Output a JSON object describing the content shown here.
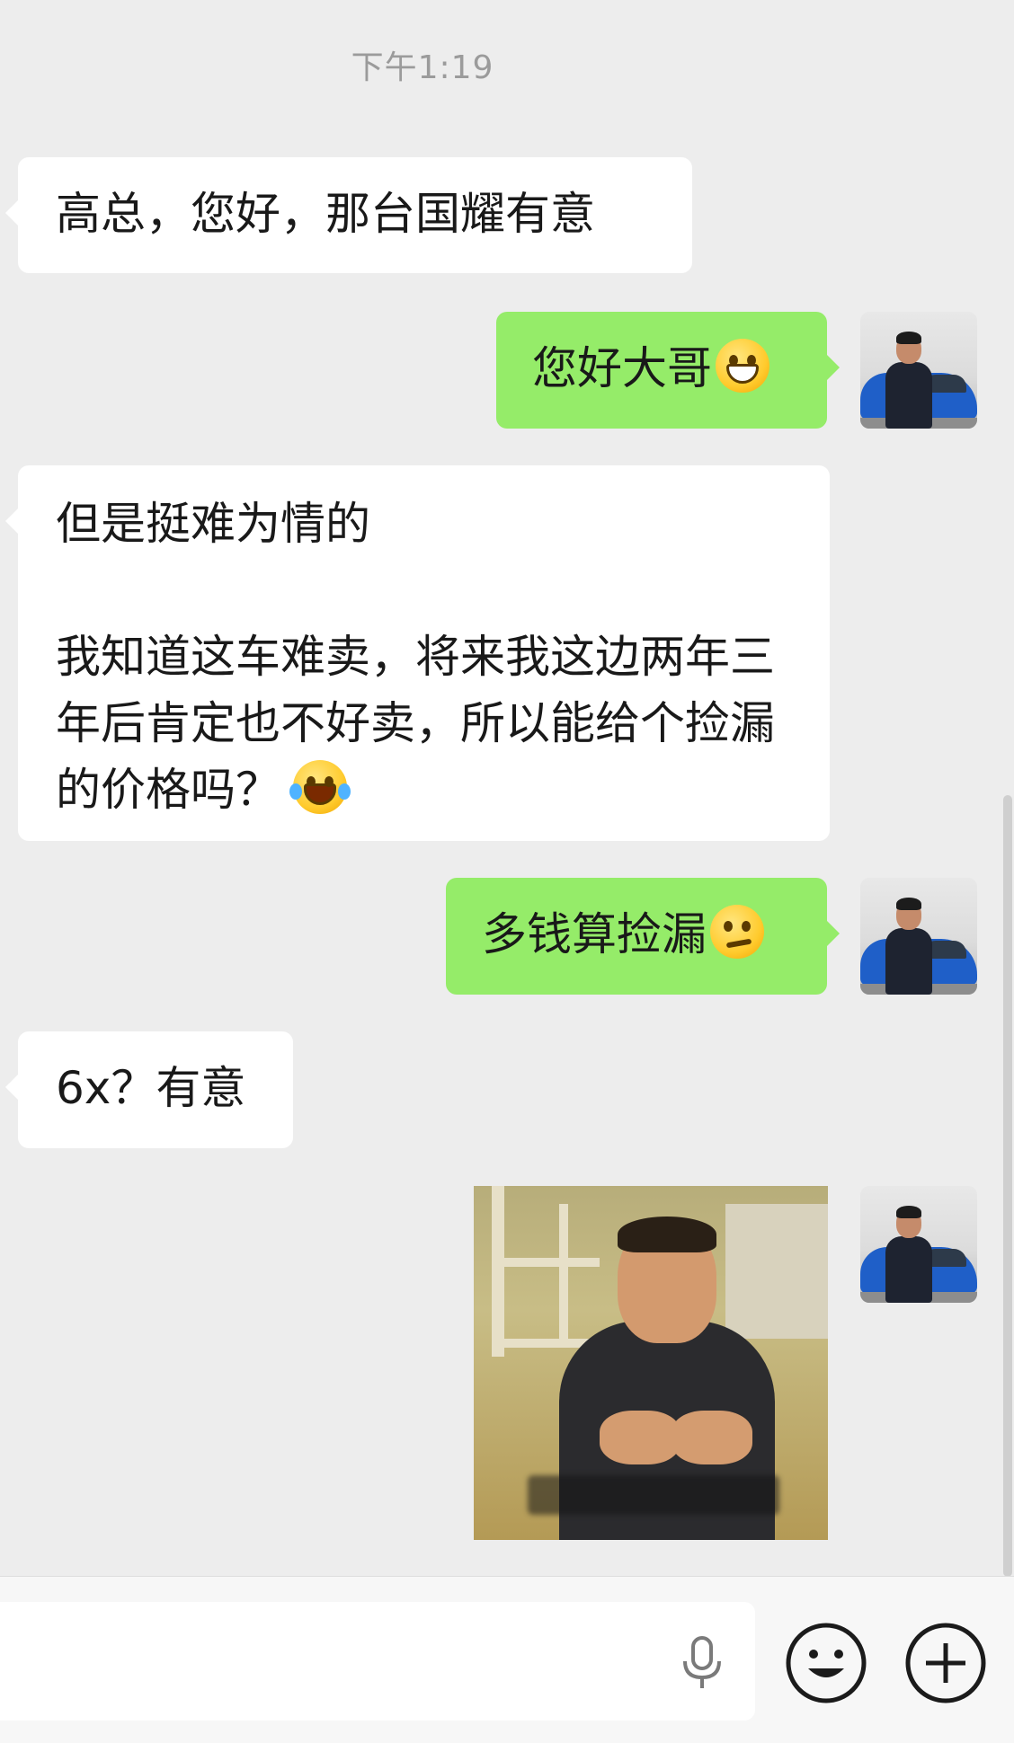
{
  "chat": {
    "timestamp": "下午1:19",
    "messages": [
      {
        "side": "left",
        "type": "text",
        "text": "高总，您好，那台国耀有意"
      },
      {
        "side": "right",
        "type": "text",
        "text": "您好大哥",
        "emoji": "grinning-emoji"
      },
      {
        "side": "left",
        "type": "text",
        "text": "但是挺难为情的\n\n我知道这车难卖，将来我这边两年三年后肯定也不好卖，所以能给个捡漏的价格吗？",
        "emoji": "tears-of-joy-emoji"
      },
      {
        "side": "right",
        "type": "text",
        "text": "多钱算捡漏",
        "emoji": "smirk-emoji"
      },
      {
        "side": "left",
        "type": "text",
        "text": "6x？有意"
      },
      {
        "side": "right",
        "type": "sticker",
        "sticker": "man-clutching-chest-sticker"
      }
    ]
  },
  "input_bar": {
    "voice_icon": "microphone-icon",
    "emoji_icon": "smiley-face-icon",
    "more_icon": "plus-icon"
  },
  "colors": {
    "background": "#ededed",
    "received_bubble": "#ffffff",
    "sent_bubble": "#95ec69",
    "timestamp": "#9b9b9b"
  }
}
